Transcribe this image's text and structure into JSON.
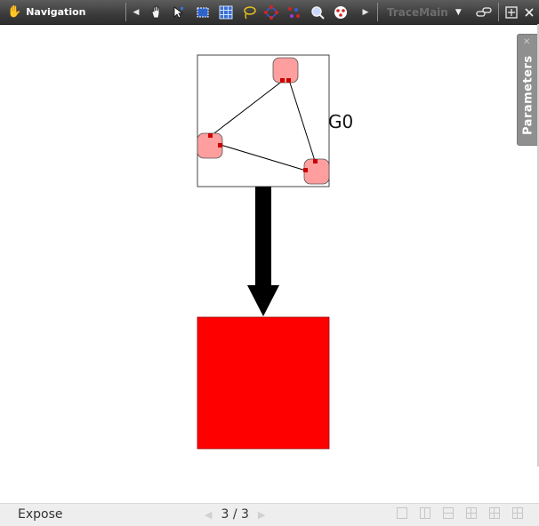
{
  "toolbar": {
    "title": "Navigation",
    "trace_selector": "TraceMain",
    "tools": [
      "pan-tool-icon",
      "select-arrow-icon",
      "rect-select-icon",
      "grid-select-icon",
      "lasso-icon",
      "node-graph-icon",
      "scatter-icon",
      "zoom-select-icon",
      "color-nodes-icon"
    ]
  },
  "side_panel": {
    "label": "Parameters"
  },
  "canvas": {
    "graph_label": "G0",
    "colors": {
      "node_fill": "#ff9e9e",
      "port": "#cc0000",
      "target": "#ff0000",
      "arrow": "#000000"
    }
  },
  "statusbar": {
    "mode": "Expose",
    "page": "3 / 3"
  }
}
